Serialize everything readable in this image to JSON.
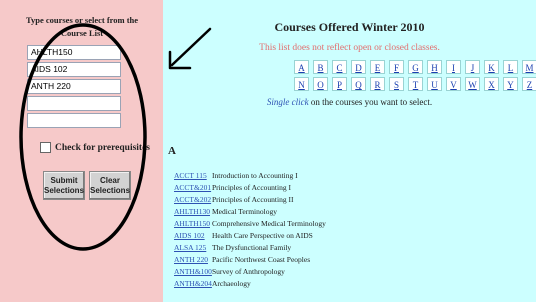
{
  "form": {
    "title": "Type courses or select from the Course List",
    "inputs": [
      "AHLTH150",
      "AIDS 102",
      "ANTH 220",
      "",
      ""
    ],
    "prereq_label": "Check for prerequisites",
    "submit_label": "Submit Selections",
    "clear_label": "Clear Selections"
  },
  "catalog": {
    "title": "Courses Offered Winter 2010",
    "notice": "This list does not reflect open or closed classes.",
    "letters": [
      "A",
      "B",
      "C",
      "D",
      "E",
      "F",
      "G",
      "H",
      "I",
      "J",
      "K",
      "L",
      "M",
      "N",
      "O",
      "P",
      "Q",
      "R",
      "S",
      "T",
      "U",
      "V",
      "W",
      "X",
      "Y",
      "Z"
    ],
    "instruction_italic": "Single click",
    "instruction_rest": "on the courses you want to select.",
    "section": "A",
    "courses": [
      {
        "code": "ACCT 115",
        "name": "Introduction to Accounting I"
      },
      {
        "code": "ACCT&201",
        "name": "Principles of Accounting I"
      },
      {
        "code": "ACCT&202",
        "name": "Principles of Accounting II"
      },
      {
        "code": "AHLTH130",
        "name": "Medical Terminology"
      },
      {
        "code": "AHLTH150",
        "name": "Comprehensive Medical Terminology"
      },
      {
        "code": "AIDS 102",
        "name": "Health Care Perspective on AIDS"
      },
      {
        "code": "ALSA 125",
        "name": "The Dysfunctional Family"
      },
      {
        "code": "ANTH 220",
        "name": "Pacific Northwest Coast Peoples"
      },
      {
        "code": "ANTH&100",
        "name": "Survey of Anthropology"
      },
      {
        "code": "ANTH&204",
        "name": "Archaeology"
      }
    ]
  },
  "colors": {
    "left_bg": "#f6c9c9",
    "right_bg": "#ccffff",
    "link": "#2d52b3",
    "notice": "#e26d6d"
  }
}
